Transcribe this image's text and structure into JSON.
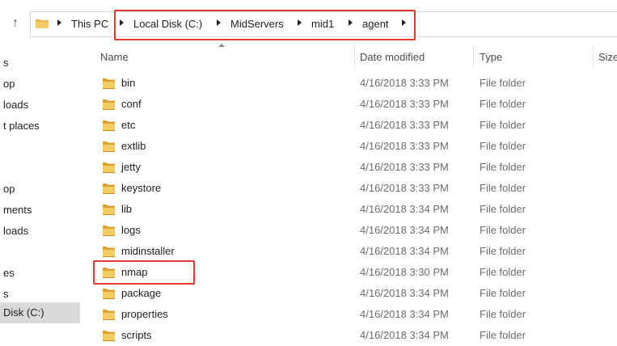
{
  "address": {
    "crumbs": [
      "This PC",
      "Local Disk (C:)",
      "MidServers",
      "mid1",
      "agent"
    ]
  },
  "nav": {
    "items": [
      "s",
      "op",
      "loads",
      "t places",
      "op",
      "ments",
      "loads",
      "es",
      "s",
      "Disk (C:)"
    ]
  },
  "columns": {
    "name": "Name",
    "date": "Date modified",
    "type": "Type",
    "size": "Size"
  },
  "files": [
    {
      "name": "bin",
      "date": "4/16/2018 3:33 PM",
      "type": "File folder"
    },
    {
      "name": "conf",
      "date": "4/16/2018 3:33 PM",
      "type": "File folder"
    },
    {
      "name": "etc",
      "date": "4/16/2018 3:33 PM",
      "type": "File folder"
    },
    {
      "name": "extlib",
      "date": "4/16/2018 3:33 PM",
      "type": "File folder"
    },
    {
      "name": "jetty",
      "date": "4/16/2018 3:33 PM",
      "type": "File folder"
    },
    {
      "name": "keystore",
      "date": "4/16/2018 3:33 PM",
      "type": "File folder"
    },
    {
      "name": "lib",
      "date": "4/16/2018 3:34 PM",
      "type": "File folder"
    },
    {
      "name": "logs",
      "date": "4/16/2018 3:34 PM",
      "type": "File folder"
    },
    {
      "name": "midinstaller",
      "date": "4/16/2018 3:34 PM",
      "type": "File folder"
    },
    {
      "name": "nmap",
      "date": "4/16/2018 3:30 PM",
      "type": "File folder"
    },
    {
      "name": "package",
      "date": "4/16/2018 3:34 PM",
      "type": "File folder"
    },
    {
      "name": "properties",
      "date": "4/16/2018 3:34 PM",
      "type": "File folder"
    },
    {
      "name": "scripts",
      "date": "4/16/2018 3:34 PM",
      "type": "File folder"
    }
  ],
  "colors": {
    "highlight_box": "#e8372b",
    "folder": "#e9b949"
  }
}
